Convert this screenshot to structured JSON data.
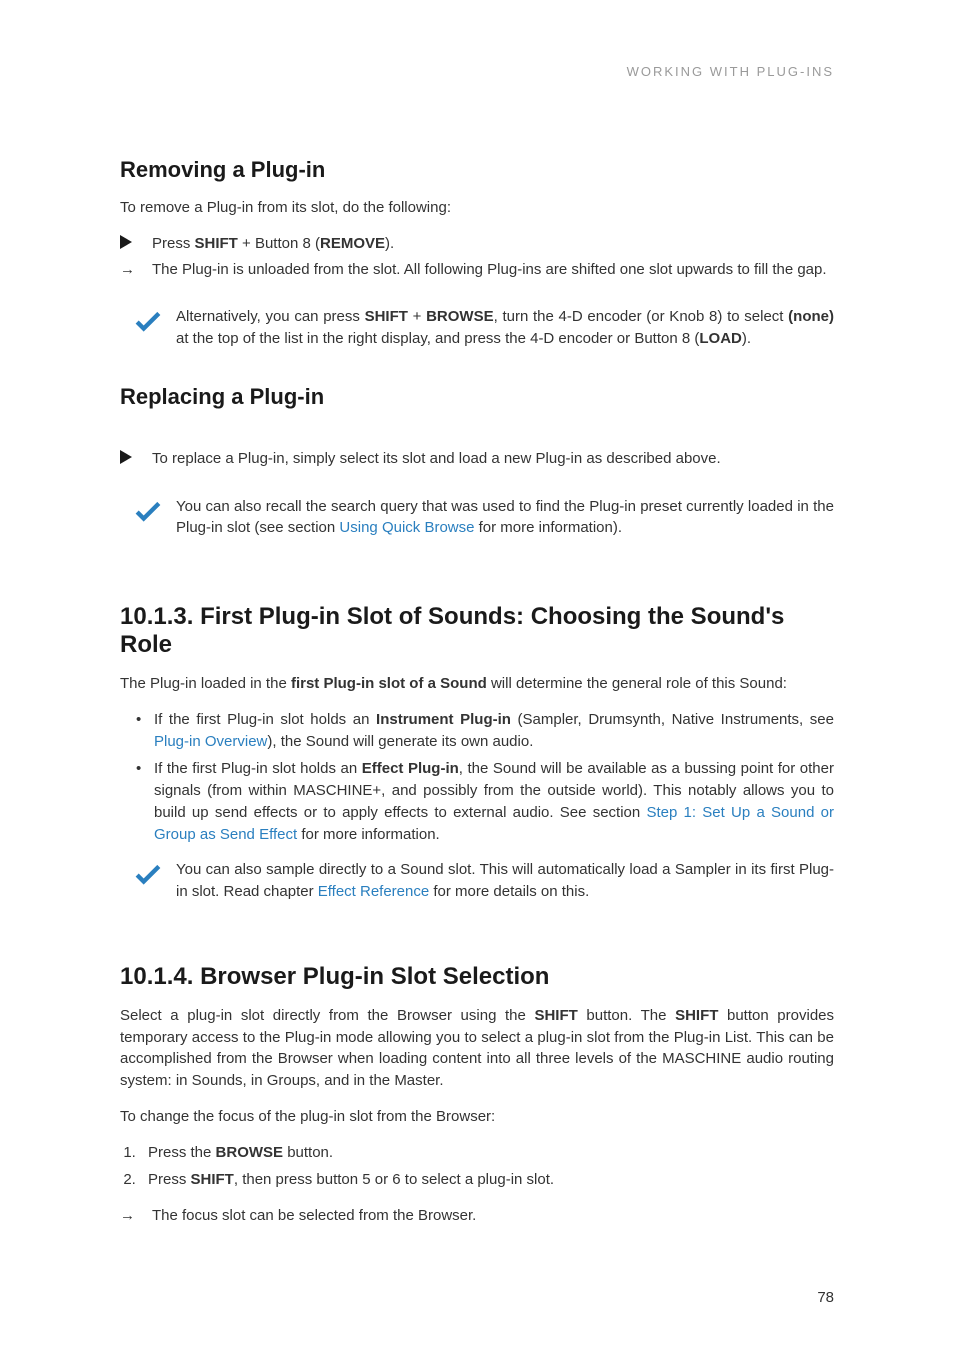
{
  "running_head": "WORKING WITH PLUG-INS",
  "page_number": "78",
  "removing": {
    "heading": "Removing a Plug-in",
    "intro": "To remove a Plug-in from its slot, do the following:",
    "step_pre": "Press ",
    "step_shift": "SHIFT",
    "step_mid": " + Button 8 (",
    "step_remove": "REMOVE",
    "step_post": ").",
    "result": "The Plug-in is unloaded from the slot. All following Plug-ins are shifted one slot upwards to fill the gap.",
    "tip_pre": "Alternatively, you can press ",
    "tip_mid1": " + ",
    "tip_browse": "BROWSE",
    "tip_mid2": ", turn the 4-D encoder (or Knob 8) to select ",
    "tip_none": "(none)",
    "tip_mid3": " at the top of the list in the right display, and press the 4-D encoder or Button 8 (",
    "tip_load": "LOAD",
    "tip_post": ")."
  },
  "replacing": {
    "heading": "Replacing a Plug-in",
    "step": "To replace a Plug-in, simply select its slot and load a new Plug-in as described above.",
    "tip_pre": "You can also recall the search query that was used to find the Plug-in preset currently loaded in the Plug-in slot (see section ",
    "tip_link": "Using Quick Browse",
    "tip_post": " for more information)."
  },
  "role": {
    "heading": "10.1.3. First Plug-in Slot of Sounds: Choosing the Sound's Role",
    "intro_pre": "The Plug-in loaded in the ",
    "intro_bold": "first Plug-in slot of a Sound",
    "intro_post": " will determine the general role of this Sound:",
    "b1_pre": "If the first Plug-in slot holds an ",
    "b1_bold": "Instrument Plug-in",
    "b1_mid": " (Sampler, Drumsynth, Native Instruments, see ",
    "b1_link": "Plug-in Overview",
    "b1_post": "), the Sound will generate its own audio.",
    "b2_pre": "If the first Plug-in slot holds an ",
    "b2_bold": "Effect Plug-in",
    "b2_mid": ", the Sound will be available as a bussing point for other signals (from within MASCHINE+, and possibly from the outside world). This notably allows you to build up send effects or to apply effects to external audio. See section ",
    "b2_link": "Step 1: Set Up a Sound or Group as Send Effect",
    "b2_post": " for more information.",
    "tip_pre": "You can also sample directly to a Sound slot. This will automatically load a Sampler in its first Plug-in slot. Read chapter ",
    "tip_link": "Effect Reference",
    "tip_post": " for more details on this."
  },
  "browser": {
    "heading": "10.1.4. Browser Plug-in Slot Selection",
    "p1_pre": "Select a plug-in slot directly from the Browser using the ",
    "p1_b1": "SHIFT",
    "p1_mid": " button. The ",
    "p1_b2": "SHIFT",
    "p1_post": " button provides temporary access to the Plug-in mode allowing you to select a plug-in slot from the Plug-in List. This can be accomplished from the Browser when loading content into all three levels of the MASCHINE audio routing system: in Sounds, in Groups, and in the Master.",
    "p2": "To change the focus of the plug-in slot from the Browser:",
    "s1_pre": "Press the ",
    "s1_b": "BROWSE",
    "s1_post": " button.",
    "s2_pre": "Press ",
    "s2_b": "SHIFT",
    "s2_post": ", then press button 5 or 6 to select a plug-in slot.",
    "result": "The focus slot can be selected from the Browser."
  }
}
